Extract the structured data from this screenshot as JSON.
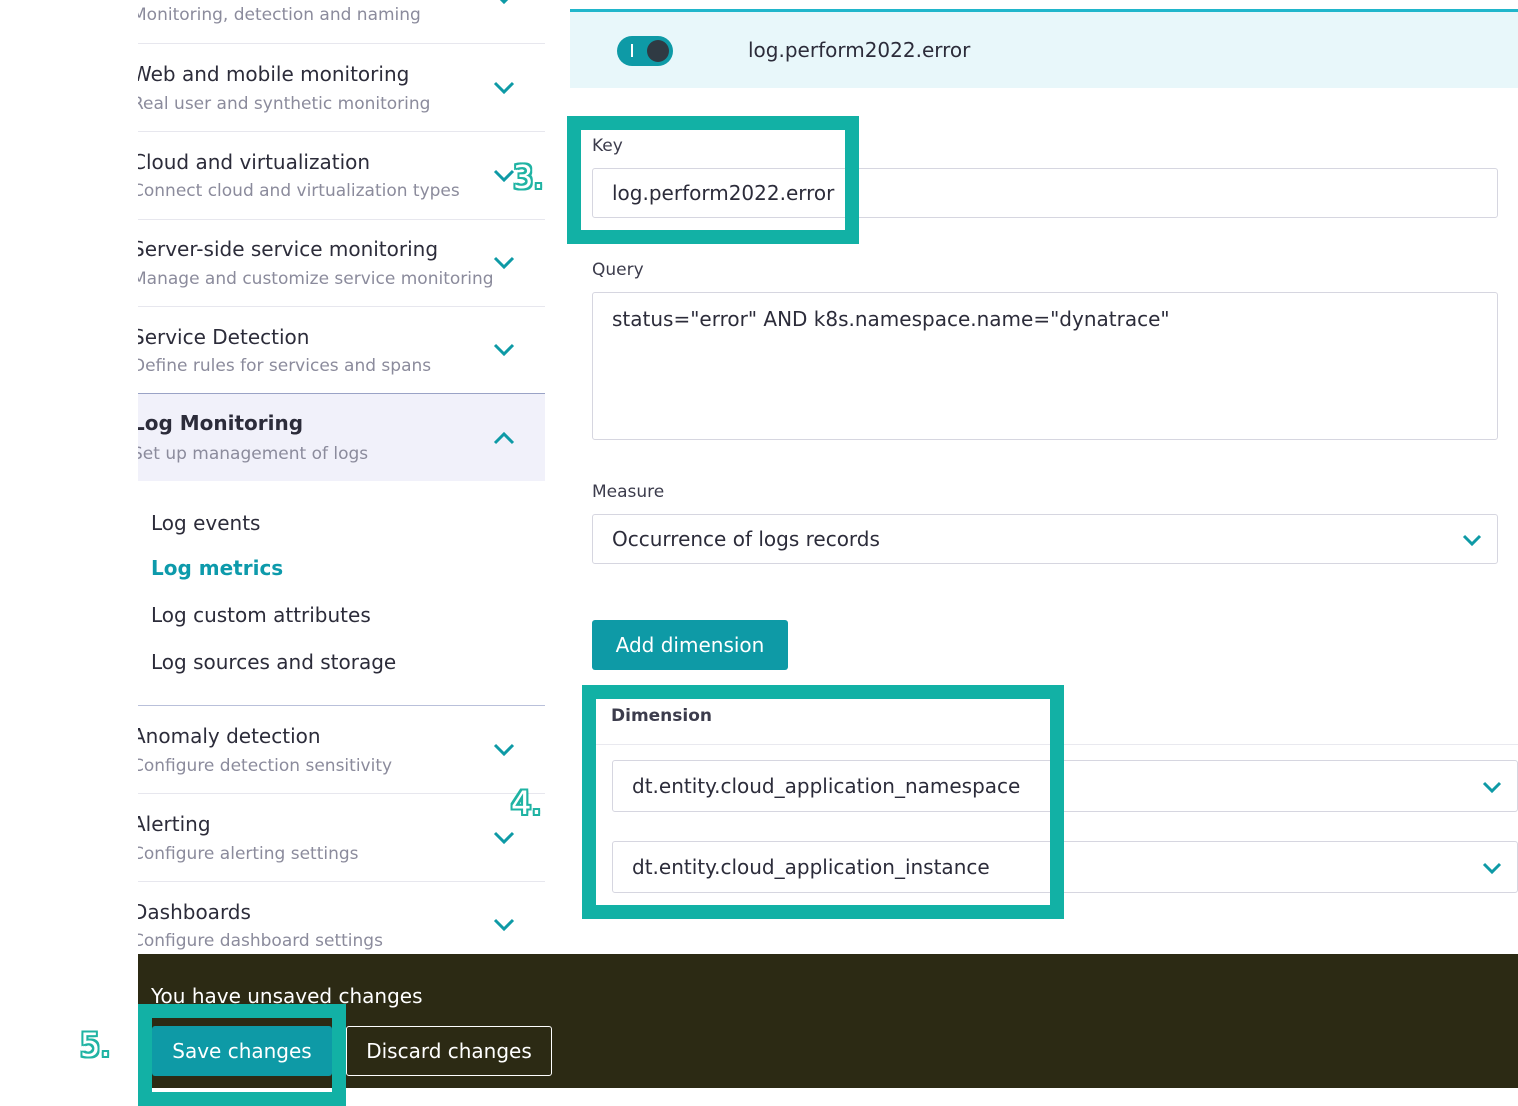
{
  "sidebar": {
    "groups": [
      {
        "title": "",
        "subtitle": "Monitoring, detection and naming"
      },
      {
        "title": "Web and mobile monitoring",
        "subtitle": "Real user and synthetic monitoring"
      },
      {
        "title": "Cloud and virtualization",
        "subtitle": "Connect cloud and virtualization types"
      },
      {
        "title": "Server-side service monitoring",
        "subtitle": "Manage and customize service monitoring"
      },
      {
        "title": "Service Detection",
        "subtitle": "Define rules for services and spans"
      },
      {
        "title": "Log Monitoring",
        "subtitle": "Set up management of logs"
      },
      {
        "title": "Anomaly detection",
        "subtitle": "Configure detection sensitivity"
      },
      {
        "title": "Alerting",
        "subtitle": "Configure alerting settings"
      },
      {
        "title": "Dashboards",
        "subtitle": "Configure dashboard settings"
      }
    ],
    "log_items": [
      "Log events",
      "Log metrics",
      "Log custom attributes",
      "Log sources and storage"
    ]
  },
  "metric": {
    "title": "log.perform2022.error",
    "enabled": true,
    "key_label": "Key",
    "key_value": "log.perform2022.error",
    "query_label": "Query",
    "query_value": "status=\"error\" AND k8s.namespace.name=\"dynatrace\"",
    "measure_label": "Measure",
    "measure_value": "Occurrence of logs records",
    "add_dimension_label": "Add dimension",
    "dimension_label": "Dimension",
    "dimensions": [
      "dt.entity.cloud_application_namespace",
      "dt.entity.cloud_application_instance"
    ]
  },
  "footer": {
    "message": "You have unsaved changes",
    "save_label": "Save changes",
    "discard_label": "Discard changes"
  },
  "steps": [
    "3.",
    "4.",
    "5."
  ],
  "colors": {
    "accent": "#0e9aa6",
    "highlight": "#12b1a5",
    "footer_bg": "#2c2a14"
  }
}
